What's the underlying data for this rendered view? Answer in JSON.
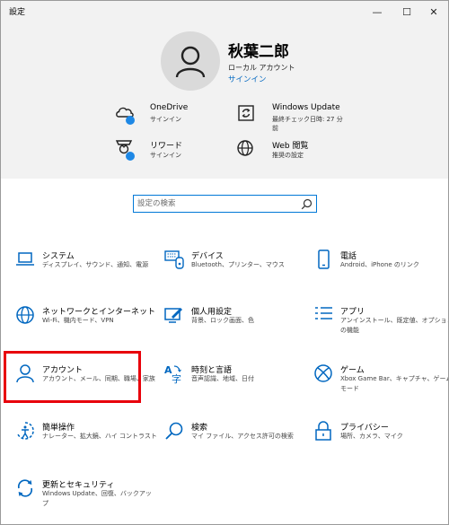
{
  "window": {
    "title": "設定",
    "controls": {
      "minimize": "—",
      "maximize": "☐",
      "close": "✕"
    }
  },
  "account": {
    "name": "秋葉二郎",
    "type": "ローカル アカウント",
    "signin": "サインイン"
  },
  "header_items": [
    {
      "title": "OneDrive",
      "sub": "サインイン",
      "icon": "cloud-icon"
    },
    {
      "title": "Windows Update",
      "sub": "最終チェック日時: 27 分前",
      "icon": "update-icon"
    },
    {
      "title": "リワード",
      "sub": "サインイン",
      "icon": "trophy-icon"
    },
    {
      "title": "Web 閲覧",
      "sub": "推奨の設定",
      "icon": "globe-icon"
    }
  ],
  "search": {
    "placeholder": "設定の検索"
  },
  "categories": [
    {
      "title": "システム",
      "desc": "ディスプレイ、サウンド、通知、電源",
      "icon": "laptop-icon"
    },
    {
      "title": "デバイス",
      "desc": "Bluetooth、プリンター、マウス",
      "icon": "devices-icon"
    },
    {
      "title": "電話",
      "desc": "Android、iPhone のリンク",
      "icon": "phone-icon"
    },
    {
      "title": "ネットワークとインターネット",
      "desc": "Wi-Fi、機内モード、VPN",
      "icon": "network-globe-icon"
    },
    {
      "title": "個人用設定",
      "desc": "背景、ロック画面、色",
      "icon": "personalization-icon"
    },
    {
      "title": "アプリ",
      "desc": "アンインストール、既定値、オプションの機能",
      "icon": "apps-icon"
    },
    {
      "title": "アカウント",
      "desc": "アカウント、メール、同期、職場、家族",
      "icon": "person-icon"
    },
    {
      "title": "時刻と言語",
      "desc": "音声認識、地域、日付",
      "icon": "time-language-icon"
    },
    {
      "title": "ゲーム",
      "desc": "Xbox Game Bar、キャプチャ、ゲーム モード",
      "icon": "xbox-icon"
    },
    {
      "title": "簡単操作",
      "desc": "ナレーター、拡大鏡、ハイ コントラスト",
      "icon": "ease-of-access-icon"
    },
    {
      "title": "検索",
      "desc": "マイ ファイル、アクセス許可の検索",
      "icon": "search-icon"
    },
    {
      "title": "プライバシー",
      "desc": "場所、カメラ、マイク",
      "icon": "lock-icon"
    },
    {
      "title": "更新とセキュリティ",
      "desc": "Windows Update、回復、バックアップ",
      "icon": "update-security-icon"
    }
  ],
  "colors": {
    "accent": "#0078d7",
    "icon_blue": "#0067c0",
    "highlight": "#e8000b",
    "header_bg": "#f2f2f2",
    "badge": "#1e88e5"
  }
}
